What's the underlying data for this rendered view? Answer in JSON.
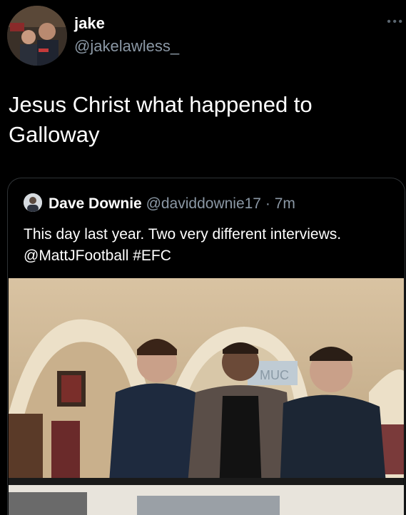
{
  "tweet": {
    "author_name": "jake",
    "author_handle": "@jakelawless_",
    "more_icon": "more-icon",
    "text": "Jesus Christ what happened to Galloway"
  },
  "quoted_tweet": {
    "author_name": "Dave Downie",
    "author_handle": "@daviddownie17",
    "separator": "·",
    "time": "7m",
    "text": "This day last year. Two very different interviews. @MattJFootball #EFC"
  },
  "photo": {
    "sign_text": "MUC"
  }
}
